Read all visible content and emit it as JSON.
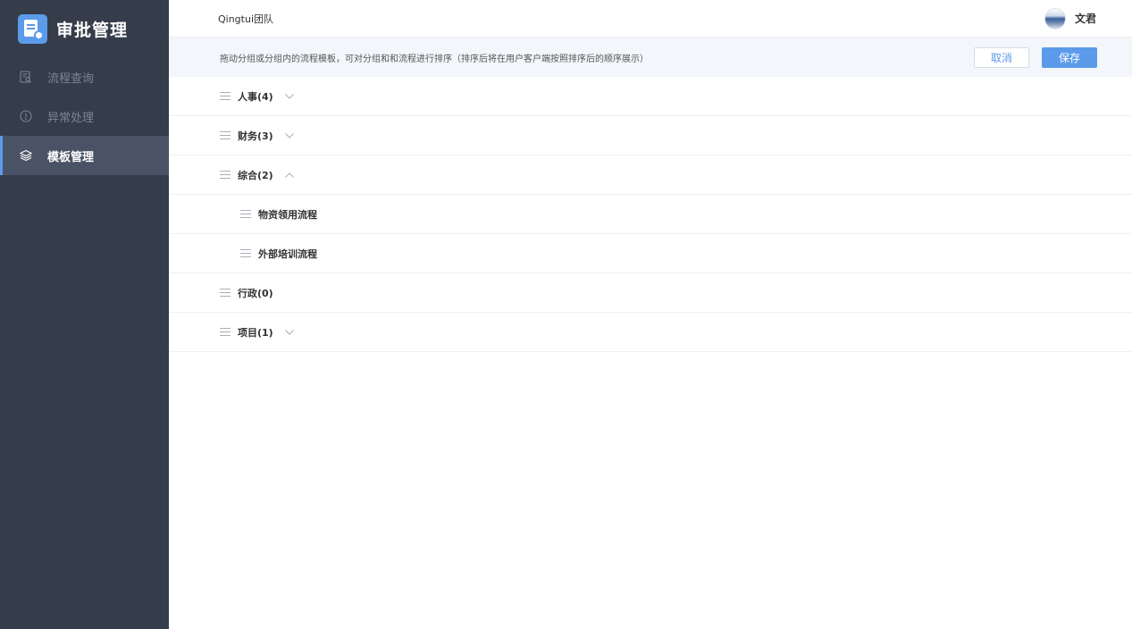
{
  "brand": {
    "title": "审批管理",
    "icon": "approval-doc-icon"
  },
  "nav": [
    {
      "label": "流程查询",
      "icon": "search-doc-icon",
      "active": false
    },
    {
      "label": "异常处理",
      "icon": "alert-circle-icon",
      "active": false
    },
    {
      "label": "模板管理",
      "icon": "layers-icon",
      "active": true
    }
  ],
  "header": {
    "team": "Qingtui团队",
    "user": "文君"
  },
  "toolbar": {
    "hint": "拖动分组或分组内的流程模板，可对分组和和流程进行排序（排序后将在用户客户端按照排序后的顺序展示）",
    "cancel": "取消",
    "save": "保存"
  },
  "groups": [
    {
      "label": "人事(4)",
      "chevron": "down"
    },
    {
      "label": "财务(3)",
      "chevron": "down"
    },
    {
      "label": "综合(2)",
      "chevron": "up"
    },
    {
      "label": "物资领用流程",
      "child": true
    },
    {
      "label": "外部培训流程",
      "child": true
    },
    {
      "label": "行政(0)"
    },
    {
      "label": "项目(1)",
      "chevron": "down"
    }
  ],
  "colors": {
    "sidebar": "#353c4a",
    "sidebar_active": "#4a5365",
    "accent": "#5b9bea",
    "toolbar_bg": "#f3f6fa"
  }
}
